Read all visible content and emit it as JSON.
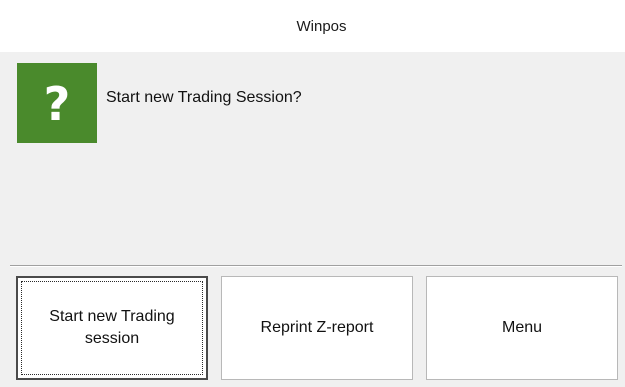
{
  "window": {
    "title": "Winpos"
  },
  "dialog": {
    "icon": "question-icon",
    "icon_glyph": "?",
    "icon_color": "#4a8a2c",
    "message": "Start new Trading Session?"
  },
  "buttons": {
    "start_label": "Start new Trading session",
    "reprint_label": "Reprint Z-report",
    "menu_label": "Menu"
  }
}
